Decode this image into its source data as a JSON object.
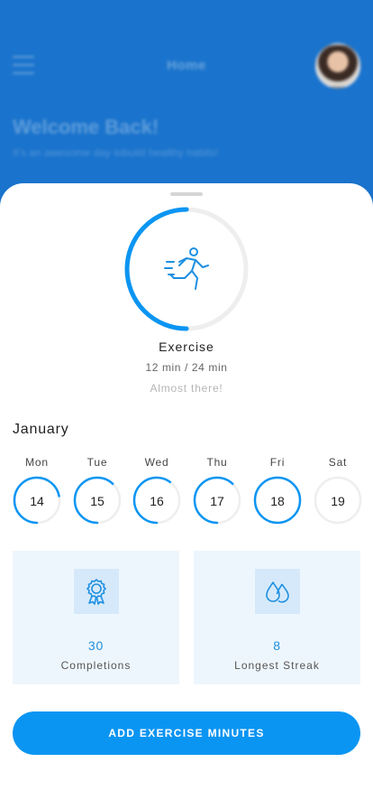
{
  "header": {
    "title": "Home",
    "welcome": "Welcome Back!",
    "subtitle": "It's an awesome day tobuild healthy habits!"
  },
  "habit": {
    "name": "Exercise",
    "progress_text": "12 min / 24 min",
    "status_text": "Almost there!",
    "progress_fraction": 0.5,
    "icon": "running-person-icon"
  },
  "calendar": {
    "month": "January",
    "days": [
      {
        "name": "Mon",
        "date": "14",
        "progress": 0.72
      },
      {
        "name": "Tue",
        "date": "15",
        "progress": 0.62
      },
      {
        "name": "Wed",
        "date": "16",
        "progress": 0.6
      },
      {
        "name": "Thu",
        "date": "17",
        "progress": 0.62
      },
      {
        "name": "Fri",
        "date": "18",
        "progress": 1.0
      },
      {
        "name": "Sat",
        "date": "19",
        "progress": 0
      }
    ]
  },
  "stats": {
    "completions": {
      "value": "30",
      "label": "Completions",
      "icon": "award-ribbon-icon"
    },
    "streak": {
      "value": "8",
      "label": "Longest Streak",
      "icon": "water-drops-icon"
    }
  },
  "cta": {
    "label": "ADD EXERCISE MINUTES"
  },
  "colors": {
    "accent": "#0b95f2",
    "track": "#eeeeee",
    "header_bg": "#1a73cc",
    "card_bg": "#eef6fd",
    "icon_box_bg": "#d5e9fa"
  }
}
